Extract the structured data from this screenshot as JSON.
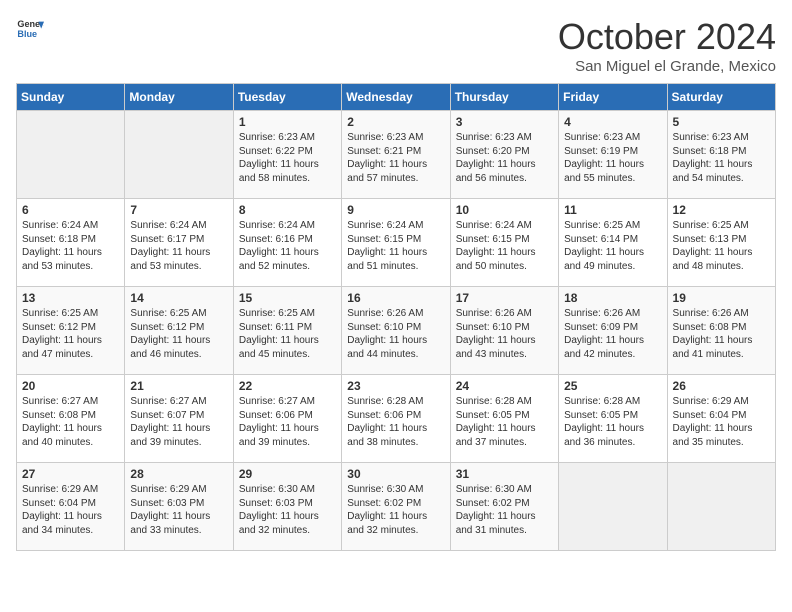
{
  "header": {
    "logo_line1": "General",
    "logo_line2": "Blue",
    "month": "October 2024",
    "location": "San Miguel el Grande, Mexico"
  },
  "days_of_week": [
    "Sunday",
    "Monday",
    "Tuesday",
    "Wednesday",
    "Thursday",
    "Friday",
    "Saturday"
  ],
  "weeks": [
    [
      {
        "day": "",
        "empty": true
      },
      {
        "day": "",
        "empty": true
      },
      {
        "day": "1",
        "sunrise": "6:23 AM",
        "sunset": "6:22 PM",
        "daylight": "11 hours and 58 minutes."
      },
      {
        "day": "2",
        "sunrise": "6:23 AM",
        "sunset": "6:21 PM",
        "daylight": "11 hours and 57 minutes."
      },
      {
        "day": "3",
        "sunrise": "6:23 AM",
        "sunset": "6:20 PM",
        "daylight": "11 hours and 56 minutes."
      },
      {
        "day": "4",
        "sunrise": "6:23 AM",
        "sunset": "6:19 PM",
        "daylight": "11 hours and 55 minutes."
      },
      {
        "day": "5",
        "sunrise": "6:23 AM",
        "sunset": "6:18 PM",
        "daylight": "11 hours and 54 minutes."
      }
    ],
    [
      {
        "day": "6",
        "sunrise": "6:24 AM",
        "sunset": "6:18 PM",
        "daylight": "11 hours and 53 minutes."
      },
      {
        "day": "7",
        "sunrise": "6:24 AM",
        "sunset": "6:17 PM",
        "daylight": "11 hours and 53 minutes."
      },
      {
        "day": "8",
        "sunrise": "6:24 AM",
        "sunset": "6:16 PM",
        "daylight": "11 hours and 52 minutes."
      },
      {
        "day": "9",
        "sunrise": "6:24 AM",
        "sunset": "6:15 PM",
        "daylight": "11 hours and 51 minutes."
      },
      {
        "day": "10",
        "sunrise": "6:24 AM",
        "sunset": "6:15 PM",
        "daylight": "11 hours and 50 minutes."
      },
      {
        "day": "11",
        "sunrise": "6:25 AM",
        "sunset": "6:14 PM",
        "daylight": "11 hours and 49 minutes."
      },
      {
        "day": "12",
        "sunrise": "6:25 AM",
        "sunset": "6:13 PM",
        "daylight": "11 hours and 48 minutes."
      }
    ],
    [
      {
        "day": "13",
        "sunrise": "6:25 AM",
        "sunset": "6:12 PM",
        "daylight": "11 hours and 47 minutes."
      },
      {
        "day": "14",
        "sunrise": "6:25 AM",
        "sunset": "6:12 PM",
        "daylight": "11 hours and 46 minutes."
      },
      {
        "day": "15",
        "sunrise": "6:25 AM",
        "sunset": "6:11 PM",
        "daylight": "11 hours and 45 minutes."
      },
      {
        "day": "16",
        "sunrise": "6:26 AM",
        "sunset": "6:10 PM",
        "daylight": "11 hours and 44 minutes."
      },
      {
        "day": "17",
        "sunrise": "6:26 AM",
        "sunset": "6:10 PM",
        "daylight": "11 hours and 43 minutes."
      },
      {
        "day": "18",
        "sunrise": "6:26 AM",
        "sunset": "6:09 PM",
        "daylight": "11 hours and 42 minutes."
      },
      {
        "day": "19",
        "sunrise": "6:26 AM",
        "sunset": "6:08 PM",
        "daylight": "11 hours and 41 minutes."
      }
    ],
    [
      {
        "day": "20",
        "sunrise": "6:27 AM",
        "sunset": "6:08 PM",
        "daylight": "11 hours and 40 minutes."
      },
      {
        "day": "21",
        "sunrise": "6:27 AM",
        "sunset": "6:07 PM",
        "daylight": "11 hours and 39 minutes."
      },
      {
        "day": "22",
        "sunrise": "6:27 AM",
        "sunset": "6:06 PM",
        "daylight": "11 hours and 39 minutes."
      },
      {
        "day": "23",
        "sunrise": "6:28 AM",
        "sunset": "6:06 PM",
        "daylight": "11 hours and 38 minutes."
      },
      {
        "day": "24",
        "sunrise": "6:28 AM",
        "sunset": "6:05 PM",
        "daylight": "11 hours and 37 minutes."
      },
      {
        "day": "25",
        "sunrise": "6:28 AM",
        "sunset": "6:05 PM",
        "daylight": "11 hours and 36 minutes."
      },
      {
        "day": "26",
        "sunrise": "6:29 AM",
        "sunset": "6:04 PM",
        "daylight": "11 hours and 35 minutes."
      }
    ],
    [
      {
        "day": "27",
        "sunrise": "6:29 AM",
        "sunset": "6:04 PM",
        "daylight": "11 hours and 34 minutes."
      },
      {
        "day": "28",
        "sunrise": "6:29 AM",
        "sunset": "6:03 PM",
        "daylight": "11 hours and 33 minutes."
      },
      {
        "day": "29",
        "sunrise": "6:30 AM",
        "sunset": "6:03 PM",
        "daylight": "11 hours and 32 minutes."
      },
      {
        "day": "30",
        "sunrise": "6:30 AM",
        "sunset": "6:02 PM",
        "daylight": "11 hours and 32 minutes."
      },
      {
        "day": "31",
        "sunrise": "6:30 AM",
        "sunset": "6:02 PM",
        "daylight": "11 hours and 31 minutes."
      },
      {
        "day": "",
        "empty": true
      },
      {
        "day": "",
        "empty": true
      }
    ]
  ],
  "labels": {
    "sunrise_prefix": "Sunrise: ",
    "sunset_prefix": "Sunset: ",
    "daylight_prefix": "Daylight: "
  }
}
